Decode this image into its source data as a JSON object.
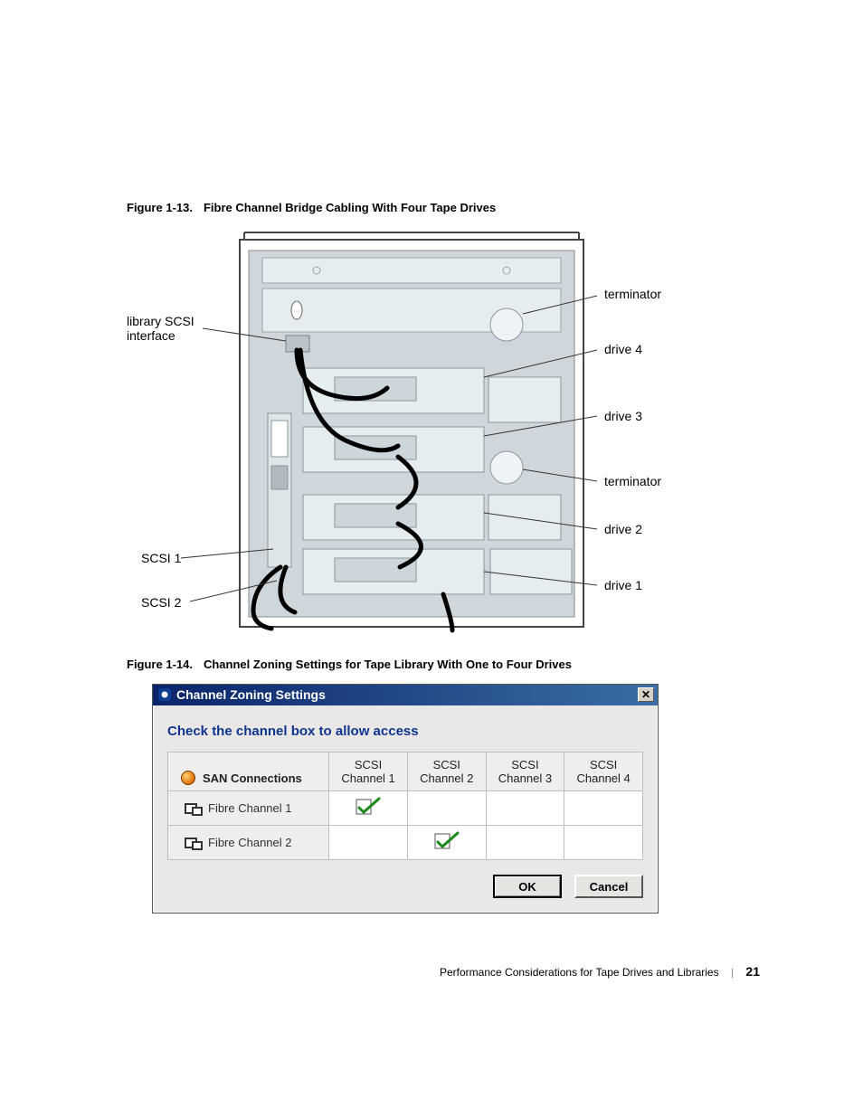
{
  "figure13": {
    "number": "Figure 1-13.",
    "title": "Fibre Channel Bridge Cabling With Four Tape Drives",
    "labels": {
      "terminator_top": "terminator",
      "drive4": "drive 4",
      "drive3": "drive 3",
      "terminator_mid": "terminator",
      "drive2": "drive 2",
      "drive1": "drive 1",
      "library_scsi_interface_line1": "library SCSI",
      "library_scsi_interface_line2": "interface",
      "scsi1": "SCSI 1",
      "scsi2": "SCSI 2"
    }
  },
  "figure14": {
    "number": "Figure 1-14.",
    "title": "Channel Zoning Settings for Tape Library With One to Four Drives"
  },
  "dialog": {
    "title": "Channel Zoning Settings",
    "subtitle": "Check the channel box to allow access",
    "columns": {
      "row_header": "SAN Connections",
      "scsi_word": "SCSI",
      "ch1": "Channel 1",
      "ch2": "Channel 2",
      "ch3": "Channel 3",
      "ch4": "Channel 4"
    },
    "rows": {
      "fc1": "Fibre Channel 1",
      "fc2": "Fibre Channel 2"
    },
    "buttons": {
      "ok": "OK",
      "cancel": "Cancel"
    },
    "close_glyph": "✕"
  },
  "footer": {
    "section": "Performance Considerations for Tape Drives and Libraries",
    "page": "21"
  },
  "chart_data": {
    "type": "table",
    "title": "Channel Zoning Settings",
    "columns": [
      "SAN Connections",
      "SCSI Channel 1",
      "SCSI Channel 2",
      "SCSI Channel 3",
      "SCSI Channel 4"
    ],
    "rows": [
      {
        "name": "Fibre Channel 1",
        "values": [
          true,
          false,
          false,
          false
        ]
      },
      {
        "name": "Fibre Channel 2",
        "values": [
          false,
          true,
          false,
          false
        ]
      }
    ]
  }
}
